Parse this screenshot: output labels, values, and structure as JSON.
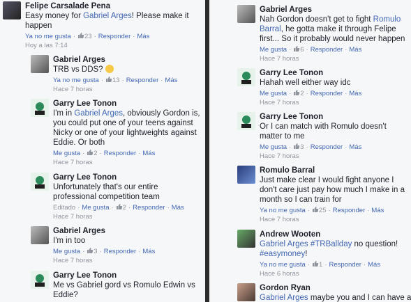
{
  "meta": {
    "reply": "Responder",
    "more": "Más",
    "unlike": "Ya no me gusta",
    "like": "Me gusta",
    "edited": "Editado"
  },
  "left": [
    {
      "author": "Felipe Carsalade Pena",
      "text_parts": [
        "Easy money for ",
        "Gabriel Arges",
        "! Please make it happen"
      ],
      "link_idx": [
        1
      ],
      "like_text": "Ya no me gusta",
      "likes": "23",
      "time": "Hoy a las 7:14"
    },
    {
      "author": "Gabriel Arges",
      "text_parts": [
        "TRB vs DDS? "
      ],
      "emoji": "thinking-emoji",
      "like_text": "Ya no me gusta",
      "likes": "13",
      "time": "Hace 7 horas"
    },
    {
      "author": "Garry Lee Tonon",
      "text_parts": [
        "I'm in ",
        "Gabriel Arges",
        ", obviously Gordon is, you could put one of your teens against Nicky or one of your lightweights against Eddie. Or both"
      ],
      "link_idx": [
        1
      ],
      "like_text": "Me gusta",
      "likes": "2",
      "time": "Hace 7 horas"
    },
    {
      "author": "Garry Lee Tonon",
      "text_parts": [
        "Unfortunately that's our entire professional competition team"
      ],
      "edited": true,
      "like_text": "Me gusta",
      "likes": "2",
      "time": "Hace 7 horas"
    },
    {
      "author": "Gabriel Arges",
      "text_parts": [
        "I'm in too"
      ],
      "like_text": "Me gusta",
      "likes": "3",
      "time": "Hace 7 horas"
    },
    {
      "author": "Garry Lee Tonon",
      "text_parts": [
        "Me vs Gabriel gord vs Romulo Edwin vs Eddie?"
      ]
    }
  ],
  "right": [
    {
      "author": "Gabriel Arges",
      "text_parts": [
        "Nah Gordon doesn't get to fight ",
        "Romulo Barral",
        ", he gotta make it through Felipe first... So it probably would never happen"
      ],
      "link_idx": [
        1
      ],
      "like_text": "Me gusta",
      "likes": "6",
      "time": "Hace 7 horas"
    },
    {
      "author": "Garry Lee Tonon",
      "text_parts": [
        "Hahah well either way idc"
      ],
      "like_text": "Me gusta",
      "likes": "2",
      "time": "Hace 7 horas"
    },
    {
      "author": "Garry Lee Tonon",
      "text_parts": [
        "Or I can match with Romulo doesn't matter to me"
      ],
      "like_text": "Me gusta",
      "likes": "3",
      "time": "Hace 7 horas"
    },
    {
      "author": "Romulo Barral",
      "text_parts": [
        "Just make clear I would fight anyone I don't care just pay how much I make in a month so I can train for"
      ],
      "like_text": "Ya no me gusta",
      "likes": "25",
      "time": "Hace 7 horas"
    },
    {
      "author": "Andrew Wooten",
      "text_parts": [
        "Gabriel Arges",
        " ",
        "#TRBallday",
        " no question! ",
        "#easymoney",
        "!"
      ],
      "link_idx": [
        0,
        2,
        4
      ],
      "like_text": "Ya no me gusta",
      "likes": "1",
      "time": "Hace 6 horas"
    },
    {
      "author": "Gordon Ryan",
      "text_parts": [
        "Gabriel Arges",
        " maybe you and I can have a"
      ],
      "link_idx": [
        0
      ]
    }
  ]
}
